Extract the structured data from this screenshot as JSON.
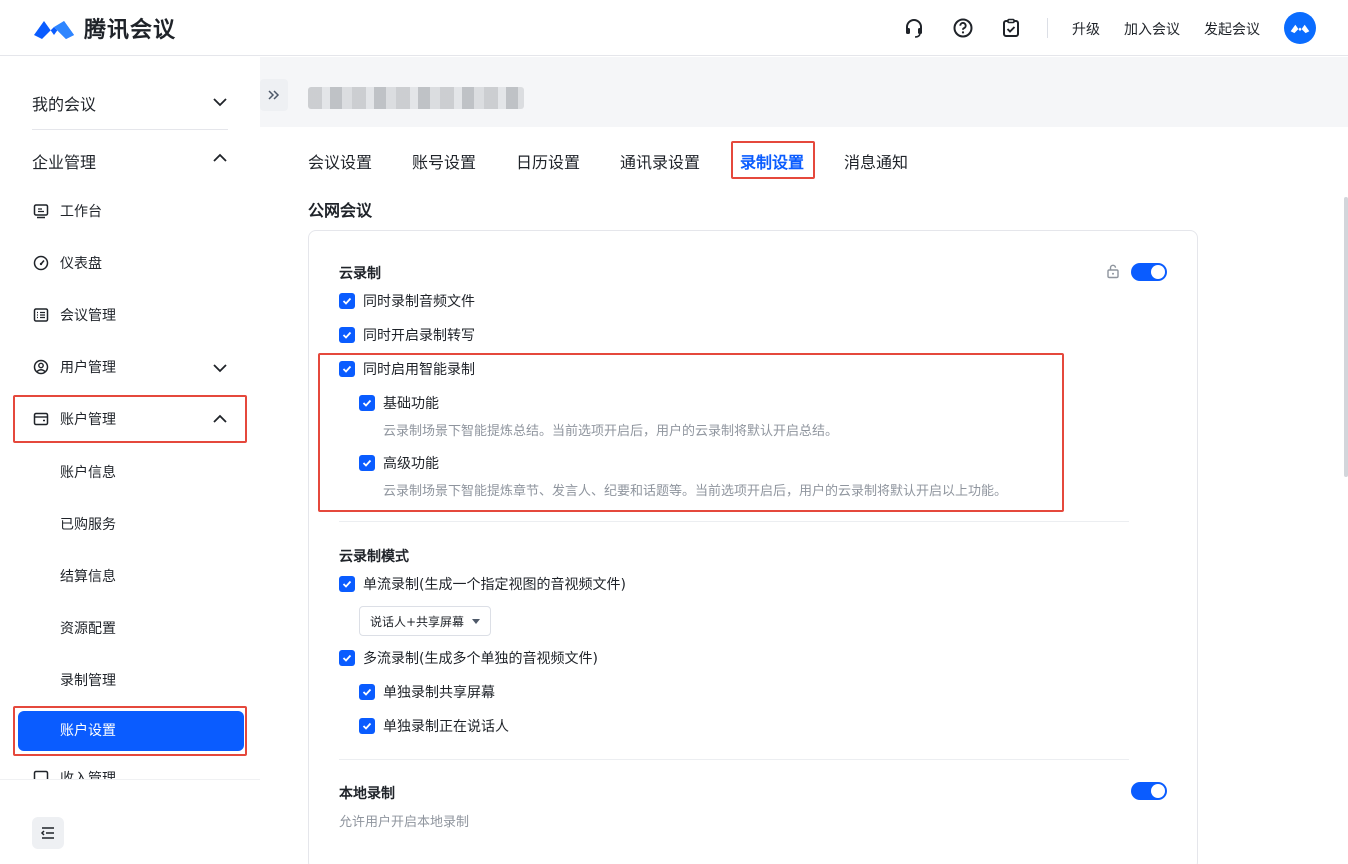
{
  "app": {
    "name": "腾讯会议"
  },
  "header": {
    "icons": [
      "headset-icon",
      "help-icon",
      "clipboard-check-icon"
    ],
    "links": {
      "upgrade": "升级",
      "join": "加入会议",
      "start": "发起会议"
    }
  },
  "sidebar": {
    "my_meetings": "我的会议",
    "enterprise": "企业管理",
    "items": {
      "workbench": "工作台",
      "dashboard": "仪表盘",
      "meeting_mgmt": "会议管理",
      "user_mgmt": "用户管理",
      "account_mgmt": "账户管理"
    },
    "account_sub": {
      "info": "账户信息",
      "purchased": "已购服务",
      "billing": "结算信息",
      "resource": "资源配置",
      "recording": "录制管理",
      "settings": "账户设置"
    },
    "partial_next": "收入管理"
  },
  "tabs": [
    "会议设置",
    "账号设置",
    "日历设置",
    "通讯录设置",
    "录制设置",
    "消息通知"
  ],
  "active_tab": "录制设置",
  "section_title": "公网会议",
  "cloud": {
    "title": "云录制",
    "enabled": true,
    "audio": "同时录制音频文件",
    "transcript": "同时开启录制转写",
    "smart": "同时启用智能录制",
    "basic": "基础功能",
    "basic_desc": "云录制场景下智能提炼总结。当前选项开启后，用户的云录制将默认开启总结。",
    "advanced": "高级功能",
    "advanced_desc": "云录制场景下智能提炼章节、发言人、纪要和话题等。当前选项开启后，用户的云录制将默认开启以上功能。"
  },
  "mode": {
    "title": "云录制模式",
    "single": "单流录制(生成一个指定视图的音视频文件)",
    "single_view": "说话人+共享屏幕",
    "multi": "多流录制(生成多个单独的音视频文件)",
    "share": "单独录制共享屏幕",
    "speaker": "单独录制正在说话人"
  },
  "local": {
    "title": "本地录制",
    "enabled": true,
    "desc": "允许用户开启本地录制"
  },
  "colors": {
    "primary": "#0a5cff",
    "highlight": "#e5483c"
  }
}
